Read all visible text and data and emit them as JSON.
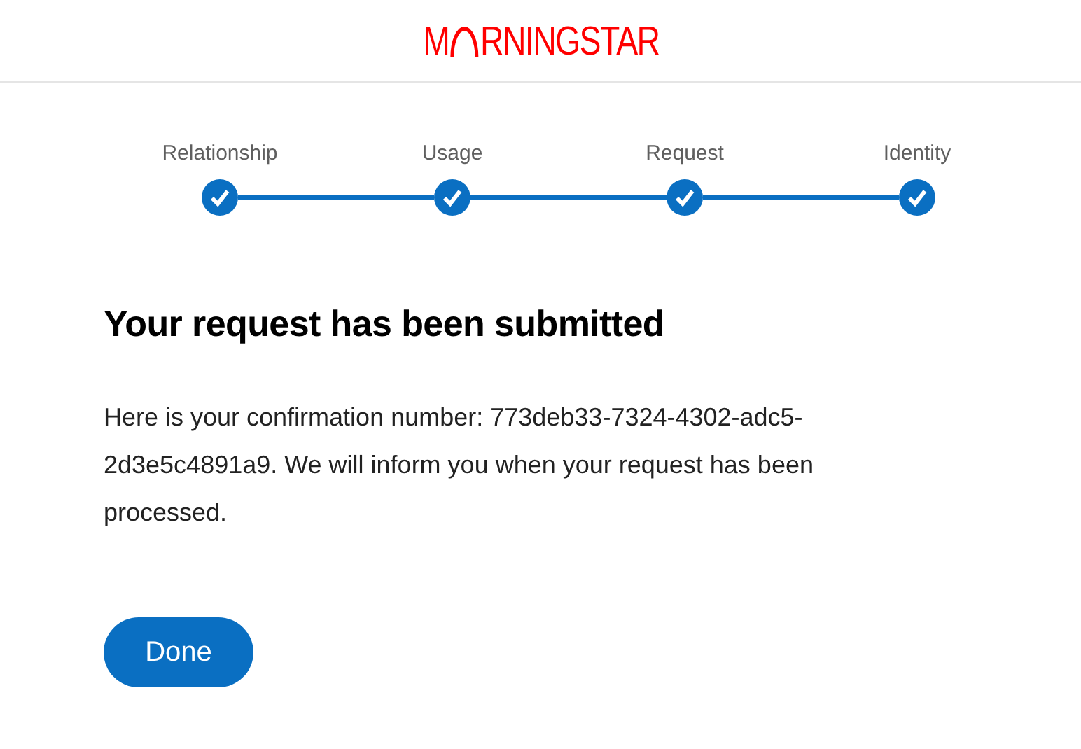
{
  "header": {
    "logo_start": "M",
    "logo_end": "RNINGSTAR"
  },
  "steps": [
    {
      "label": "Relationship",
      "completed": true
    },
    {
      "label": "Usage",
      "completed": true
    },
    {
      "label": "Request",
      "completed": true
    },
    {
      "label": "Identity",
      "completed": true
    }
  ],
  "title": "Your request has been submitted",
  "message": "Here is your confirmation number: 773deb33-7324-4302-adc5-2d3e5c4891a9. We will inform you when your request has been processed.",
  "buttons": [
    "Done"
  ]
}
